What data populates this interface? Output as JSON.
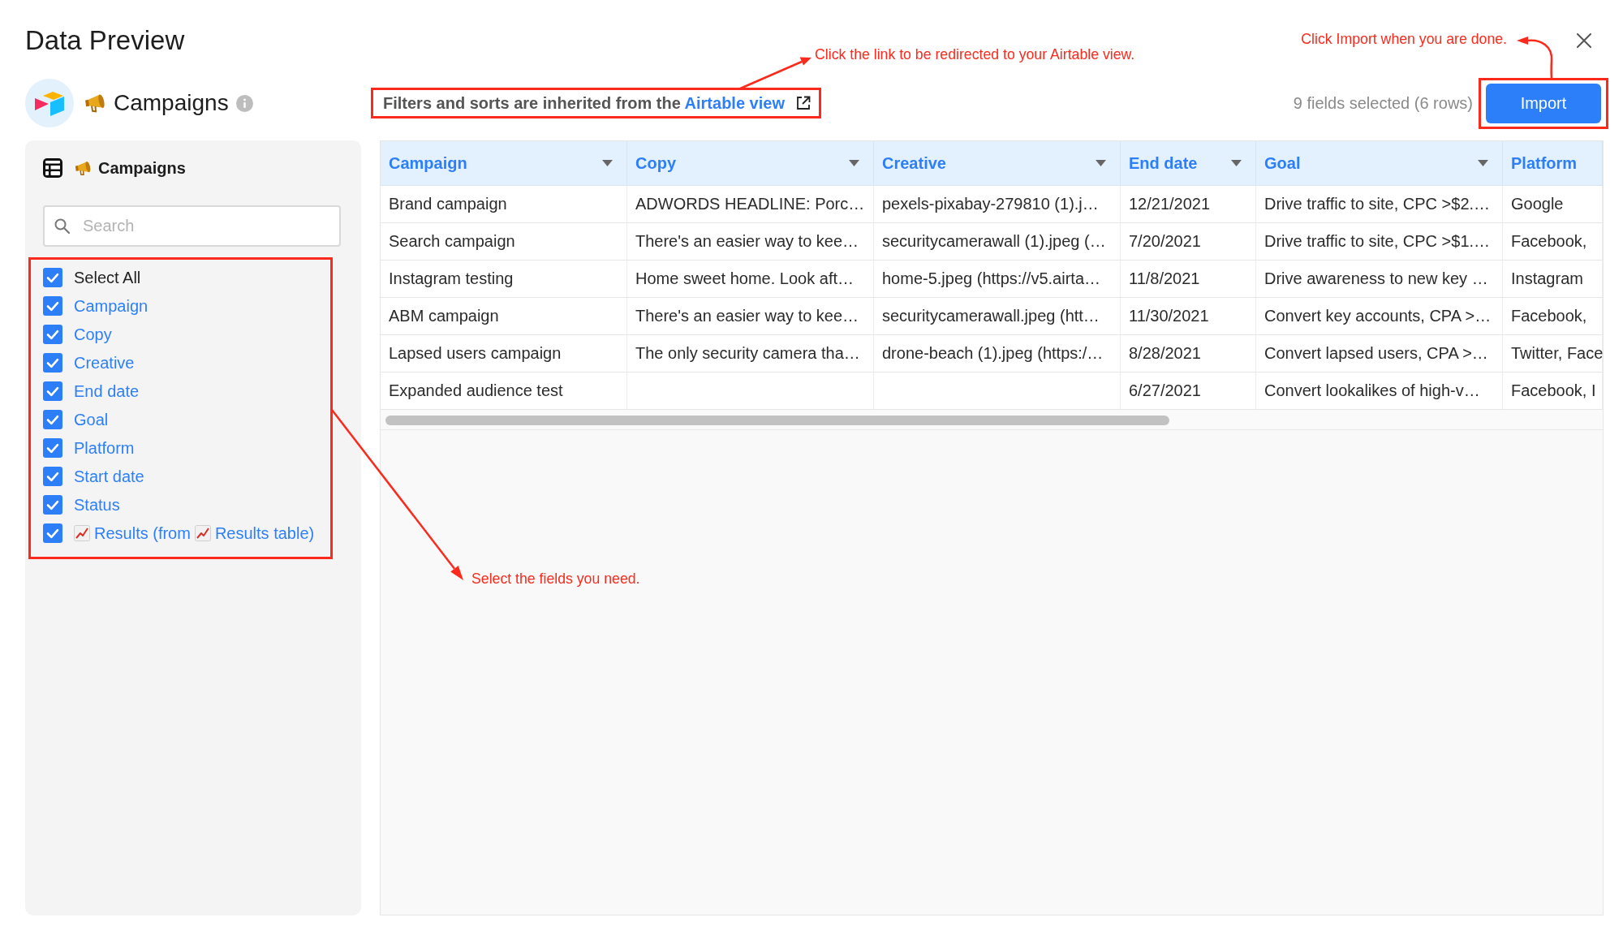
{
  "dialog": {
    "title": "Data Preview"
  },
  "source": {
    "table_name": "Campaigns"
  },
  "banner": {
    "text": "Filters and sorts are inherited from the",
    "link": "Airtable view",
    "highlighted": true
  },
  "selection_summary": "9 fields selected (6 rows)",
  "import_button": {
    "label": "Import",
    "highlighted": true
  },
  "sidebar": {
    "table_name": "Campaigns",
    "search": {
      "placeholder": "Search"
    },
    "fields_highlighted": true,
    "fields": [
      {
        "kind": "all",
        "label": "Select All",
        "checked": true
      },
      {
        "kind": "field",
        "label": "Campaign",
        "checked": true
      },
      {
        "kind": "field",
        "label": "Copy",
        "checked": true
      },
      {
        "kind": "field",
        "label": "Creative",
        "checked": true
      },
      {
        "kind": "field",
        "label": "End date",
        "checked": true
      },
      {
        "kind": "field",
        "label": "Goal",
        "checked": true
      },
      {
        "kind": "field",
        "label": "Platform",
        "checked": true
      },
      {
        "kind": "field",
        "label": "Start date",
        "checked": true
      },
      {
        "kind": "field",
        "label": "Status",
        "checked": true
      },
      {
        "kind": "lookup",
        "label": "Results (from",
        "suffix": "Results table)",
        "checked": true
      }
    ]
  },
  "table": {
    "columns": [
      {
        "label": "Campaign",
        "has_menu": true
      },
      {
        "label": "Copy",
        "has_menu": true
      },
      {
        "label": "Creative",
        "has_menu": true
      },
      {
        "label": "End date",
        "has_menu": true
      },
      {
        "label": "Goal",
        "has_menu": true
      },
      {
        "label": "Platform",
        "has_menu": false
      }
    ],
    "rows": [
      [
        "Brand campaign",
        "ADWORDS HEADLINE: Porc…",
        "pexels-pixabay-279810 (1).j…",
        "12/21/2021",
        "Drive traffic to site, CPC >$2.…",
        "Google"
      ],
      [
        "Search campaign",
        "There's an easier way to kee…",
        "securitycamerawall (1).jpeg (…",
        "7/20/2021",
        "Drive traffic to site, CPC >$1.…",
        "Facebook,"
      ],
      [
        "Instagram testing",
        "Home sweet home. Look aft…",
        "home-5.jpeg (https://v5.airta…",
        "11/8/2021",
        "Drive awareness to new key …",
        "Instagram"
      ],
      [
        "ABM campaign",
        "There's an easier way to kee…",
        "securitycamerawall.jpeg (htt…",
        "11/30/2021",
        "Convert key accounts, CPA >…",
        "Facebook,"
      ],
      [
        "Lapsed users campaign",
        "The only security camera tha…",
        "drone-beach (1).jpeg (https:/…",
        "8/28/2021",
        "Convert lapsed users, CPA >…",
        "Twitter, Face"
      ],
      [
        "Expanded audience test",
        null,
        null,
        "6/27/2021",
        "Convert lookalikes of high-v…",
        "Facebook, I"
      ]
    ]
  },
  "annotations": [
    {
      "text": "Click the link to be redirected to your Airtable view."
    },
    {
      "text": "Click Import when you are done."
    },
    {
      "text": "Select the fields you need."
    }
  ]
}
